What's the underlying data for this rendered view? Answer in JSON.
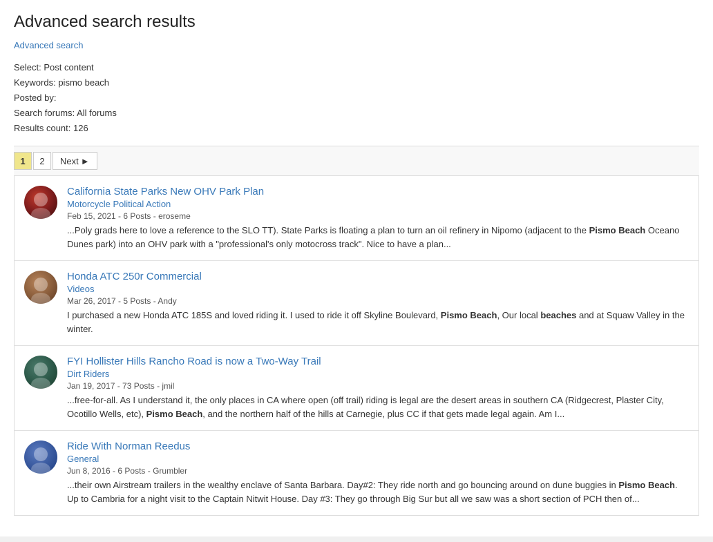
{
  "page": {
    "title": "Advanced search results",
    "advanced_search_link": "Advanced search"
  },
  "search_meta": {
    "select_label": "Select:",
    "select_value": "Post content",
    "keywords_label": "Keywords:",
    "keywords_value": "pismo beach",
    "posted_by_label": "Posted by:",
    "posted_by_value": "",
    "forums_label": "Search forums:",
    "forums_value": "All forums",
    "results_label": "Results count:",
    "results_value": "126"
  },
  "pagination": {
    "pages": [
      {
        "label": "1",
        "active": true
      },
      {
        "label": "2",
        "active": false
      }
    ],
    "next_label": "Next"
  },
  "results": [
    {
      "id": 1,
      "title": "California State Parks New OHV Park Plan",
      "category": "Motorcycle Political Action",
      "meta": "Feb 15, 2021 - 6 Posts - eroseme",
      "excerpt_parts": [
        {
          "text": "...Poly grads here to love a reference to the SLO TT). State Parks is floating a plan to turn an oil refinery in Nipomo (adjacent to the ",
          "bold": false
        },
        {
          "text": "Pismo Beach",
          "bold": true
        },
        {
          "text": " Oceano Dunes park) into an OHV park with a \"professional's only motocross track\". Nice to have a plan...",
          "bold": false
        }
      ],
      "avatar_class": "avatar-1"
    },
    {
      "id": 2,
      "title": "Honda ATC 250r Commercial",
      "category": "Videos",
      "meta": "Mar 26, 2017 - 5 Posts - Andy",
      "excerpt_parts": [
        {
          "text": "I purchased a new Honda ATC 185S and loved riding it. I used to ride it off Skyline Boulevard, ",
          "bold": false
        },
        {
          "text": "Pismo Beach",
          "bold": true
        },
        {
          "text": ", Our local ",
          "bold": false
        },
        {
          "text": "beaches",
          "bold": true
        },
        {
          "text": " and at Squaw Valley in the winter.",
          "bold": false
        }
      ],
      "avatar_class": "avatar-2"
    },
    {
      "id": 3,
      "title": "FYI Hollister Hills Rancho Road is now a Two-Way Trail",
      "category": "Dirt Riders",
      "meta": "Jan 19, 2017 - 73 Posts - jmil",
      "excerpt_parts": [
        {
          "text": "...free-for-all. As I understand it, the only places in CA where open (off trail) riding is legal are the desert areas in southern CA (Ridgecrest, Plaster City, Ocotillo Wells, etc), ",
          "bold": false
        },
        {
          "text": "Pismo Beach",
          "bold": true
        },
        {
          "text": ", and the northern half of the hills at Carnegie, plus CC if that gets made legal again. Am I...",
          "bold": false
        }
      ],
      "avatar_class": "avatar-3"
    },
    {
      "id": 4,
      "title": "Ride With Norman Reedus",
      "category": "General",
      "meta": "Jun 8, 2016 - 6 Posts - Grumbler",
      "excerpt_parts": [
        {
          "text": "...their own Airstream trailers in the wealthy enclave of Santa Barbara. Day#2: They ride north and go bouncing around on dune buggies in ",
          "bold": false
        },
        {
          "text": "Pismo",
          "bold": true
        },
        {
          "text": " ",
          "bold": false
        },
        {
          "text": "Beach",
          "bold": true
        },
        {
          "text": ". Up to Cambria for a night visit to the Captain Nitwit House. Day #3: They go through Big Sur but all we saw was a short section of PCH then of...",
          "bold": false
        }
      ],
      "avatar_class": "avatar-4"
    }
  ]
}
